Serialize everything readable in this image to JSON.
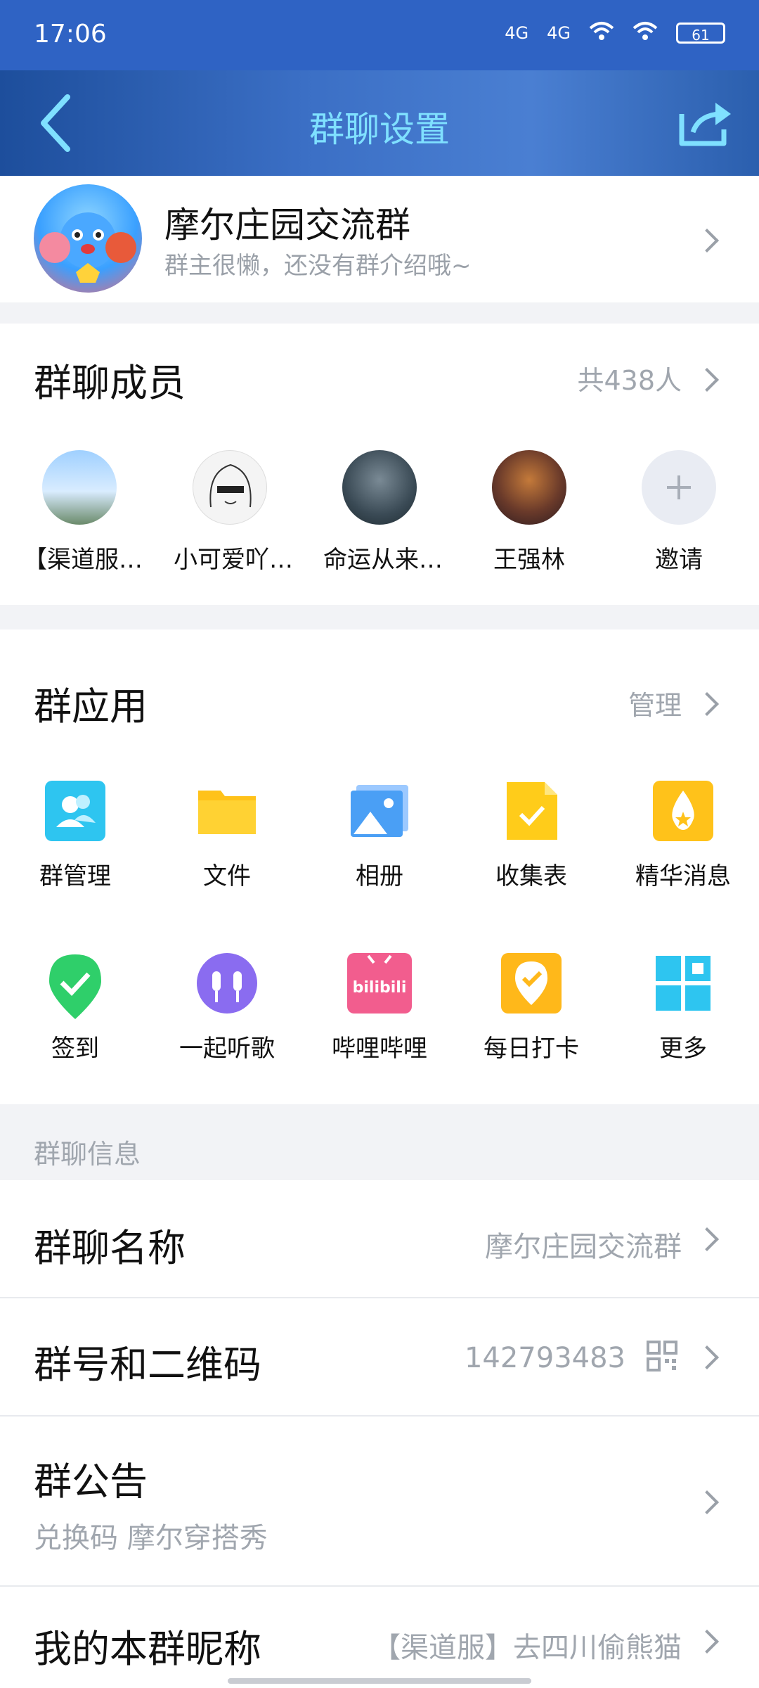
{
  "status_bar": {
    "time": "17:06",
    "net1": "4G",
    "net2": "4G",
    "battery": "61"
  },
  "title_bar": {
    "title": "群聊设置"
  },
  "group": {
    "name": "摩尔庄园交流群",
    "description": "群主很懒，还没有群介绍哦~"
  },
  "members": {
    "title": "群聊成员",
    "count_text": "共438人",
    "items": [
      {
        "label": "【渠道服…",
        "avatar_color": "#7fb8e6"
      },
      {
        "label": "小可爱吖…",
        "avatar_color": "#f4f4f4"
      },
      {
        "label": "命运从来…",
        "avatar_color": "#3a4a55"
      },
      {
        "label": "王强林",
        "avatar_color": "#6a3a2a"
      },
      {
        "label": "邀请",
        "avatar_color": "#e9ecf3"
      }
    ]
  },
  "apps": {
    "title": "群应用",
    "manage_label": "管理",
    "items": [
      {
        "label": "群管理",
        "icon": "group-manage-icon",
        "color": "#2ec5f0"
      },
      {
        "label": "文件",
        "icon": "folder-icon",
        "color": "#ffc21a"
      },
      {
        "label": "相册",
        "icon": "photo-album-icon",
        "color": "#4a9ff5"
      },
      {
        "label": "收集表",
        "icon": "form-icon",
        "color": "#ffcc1a"
      },
      {
        "label": "精华消息",
        "icon": "essence-icon",
        "color": "#ffc21a"
      },
      {
        "label": "签到",
        "icon": "check-in-icon",
        "color": "#2fcf6a"
      },
      {
        "label": "一起听歌",
        "icon": "headphone-icon",
        "color": "#8a6cf0"
      },
      {
        "label": "哔哩哔哩",
        "icon": "bilibili-icon",
        "color": "#f25d8e"
      },
      {
        "label": "每日打卡",
        "icon": "daily-punch-icon",
        "color": "#ffb81a"
      },
      {
        "label": "更多",
        "icon": "more-grid-icon",
        "color": "#2ec5f0"
      }
    ]
  },
  "info": {
    "section_label": "群聊信息",
    "rows": [
      {
        "title": "群聊名称",
        "value": "摩尔庄园交流群"
      },
      {
        "title": "群号和二维码",
        "value": "142793483"
      },
      {
        "title": "群公告",
        "sub": "兑换码 摩尔穿搭秀"
      },
      {
        "title": "我的本群昵称",
        "value": "【渠道服】去四川偷熊猫"
      }
    ]
  },
  "colors": {
    "status_bar": "#2f63c4",
    "title_text": "#7fe0ff",
    "secondary_text": "#a0a6ae",
    "divider_gap": "#f2f3f6"
  }
}
